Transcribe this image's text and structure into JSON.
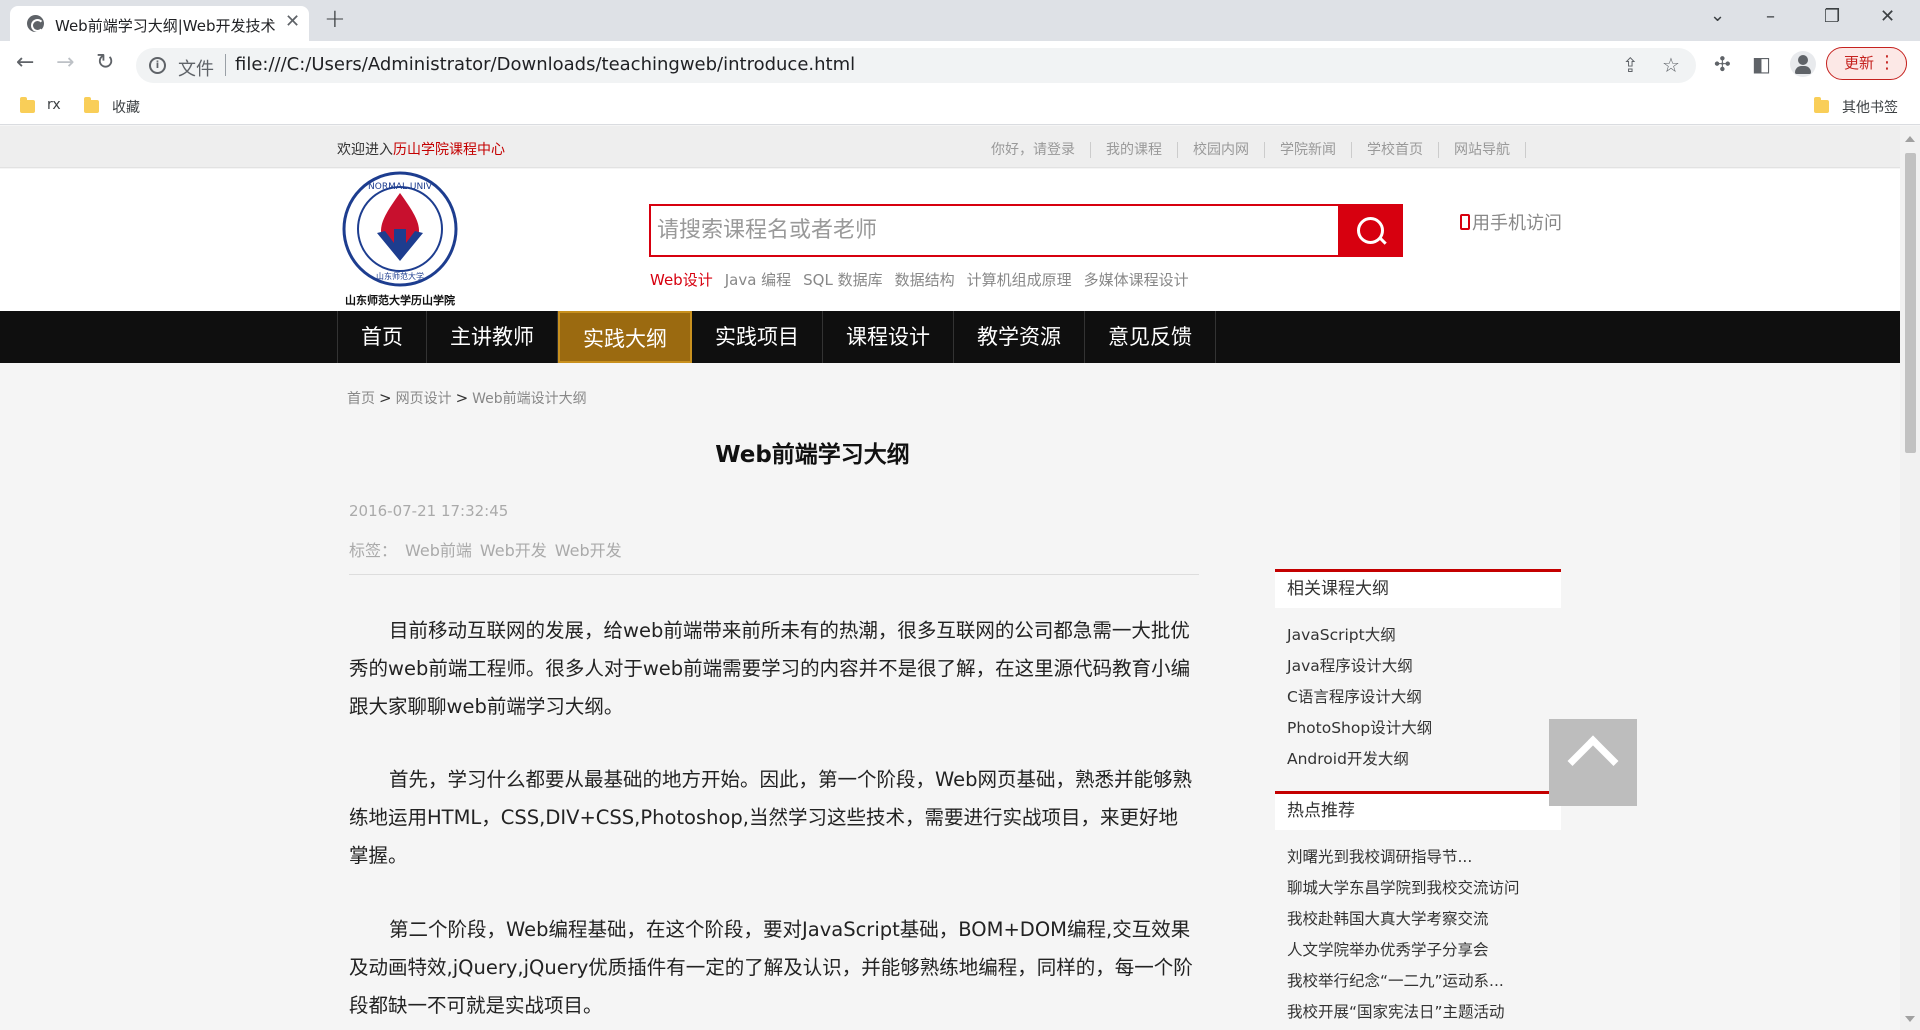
{
  "browser": {
    "tab_title": "Web前端学习大纲|Web开发技术",
    "file_label": "文件",
    "url": "file:///C:/Users/Administrator/Downloads/teachingweb/introduce.html",
    "update_label": "更新",
    "bookmarks": [
      "rx",
      "收藏"
    ],
    "other_bookmarks": "其他书签"
  },
  "site": {
    "welcome_prefix": "欢迎进入",
    "welcome_name": "历山学院课程中心",
    "top_links": [
      "你好，请登录",
      "我的课程",
      "校园内网",
      "学院新闻",
      "学校首页",
      "网站导航"
    ],
    "logo_caption": "山东师范大学历山学院",
    "search_placeholder": "请搜索课程名或者老师",
    "hot_words": [
      "Web设计",
      "Java 编程",
      "SQL 数据库",
      "数据结构",
      "计算机组成原理",
      "多媒体课程设计"
    ],
    "mobile_label": "用手机访问",
    "nav": [
      "首页",
      "主讲教师",
      "实践大纲",
      "实践项目",
      "课程设计",
      "教学资源",
      "意见反馈"
    ],
    "active_nav": "实践大纲",
    "colors": {
      "brand_red": "#d7000f",
      "nav_bg": "#0f0f0f",
      "nav_active": "#9b6a10"
    }
  },
  "article": {
    "breadcrumb": [
      "首页",
      "网页设计",
      "Web前端设计大纲"
    ],
    "title": "Web前端学习大纲",
    "date": "2016-07-21 17:32:45",
    "tags_label": "标签：",
    "tags": [
      "Web前端",
      "Web开发",
      "Web开发"
    ],
    "paragraphs": [
      "目前移动互联网的发展，给web前端带来前所未有的热潮，很多互联网的公司都急需一大批优秀的web前端工程师。很多人对于web前端需要学习的内容并不是很了解，在这里源代码教育小编跟大家聊聊web前端学习大纲。",
      "首先，学习什么都要从最基础的地方开始。因此，第一个阶段，Web网页基础，熟悉并能够熟练地运用HTML，CSS,DIV+CSS,Photoshop,当然学习这些技术，需要进行实战项目，来更好地掌握。",
      "第二个阶段，Web编程基础，在这个阶段，要对JavaScript基础，BOM+DOM编程,交互效果及动画特效,jQuery,jQuery优质插件有一定的了解及认识，并能够熟练地编程，同样的，每一个阶段都缺一不可就是实战项目。"
    ]
  },
  "sidebar": {
    "related_title": "相关课程大纲",
    "related": [
      "JavaScript大纲",
      "Java程序设计大纲",
      "C语言程序设计大纲",
      "PhotoShop设计大纲",
      "Android开发大纲"
    ],
    "hot_title": "热点推荐",
    "hot": [
      "刘曙光到我校调研指导节...",
      "聊城大学东昌学院到我校交流访问",
      "我校赴韩国大真大学考察交流",
      "人文学院举办优秀学子分享会",
      "我校举行纪念“一二九”运动系...",
      "我校开展“国家宪法日”主题活动"
    ]
  }
}
